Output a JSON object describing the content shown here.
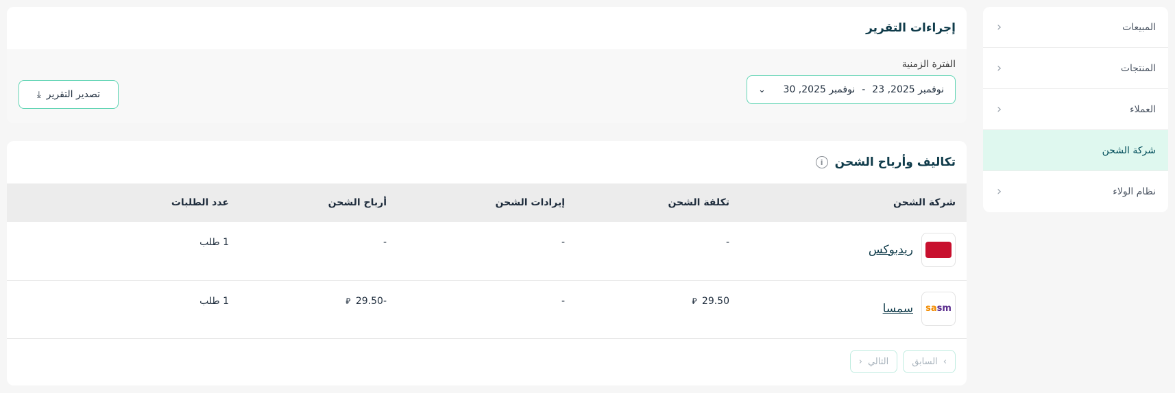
{
  "sidebar": {
    "items": [
      {
        "label": "المبيعات"
      },
      {
        "label": "المنتجات"
      },
      {
        "label": "العملاء"
      },
      {
        "label": "شركة الشحن"
      },
      {
        "label": "نظام الولاء"
      }
    ]
  },
  "report_actions": {
    "title": "إجراءات التقرير",
    "period_label": "الفترة الزمنية",
    "date_from": "نوفمبر 2025, 23",
    "date_sep": "-",
    "date_to": "نوفمبر 2025, 30",
    "export_label": "تصدير التقرير"
  },
  "shipping_table": {
    "title": "تكاليف وأرباح الشحن",
    "columns": [
      "شركة الشحن",
      "تكلفة الشحن",
      "إيرادات الشحن",
      "أرباح الشحن",
      "عدد الطلبات"
    ],
    "rows": [
      {
        "company": "ريدبوكس",
        "cost": "-",
        "cost_currency": "",
        "revenue": "-",
        "profit": "-",
        "profit_currency": "",
        "orders": "1 طلب"
      },
      {
        "company": "سمسا",
        "cost": "29.50",
        "cost_currency": "⃁",
        "revenue": "-",
        "profit": "-29.50",
        "profit_currency": "⃁",
        "orders": "1 طلب"
      }
    ],
    "pager": {
      "prev": "السابق",
      "next": "التالي"
    }
  },
  "colors": {
    "accent_border": "#5fd4b3",
    "active_bg": "#dff8ef",
    "title_text": "#0f3b4a"
  }
}
